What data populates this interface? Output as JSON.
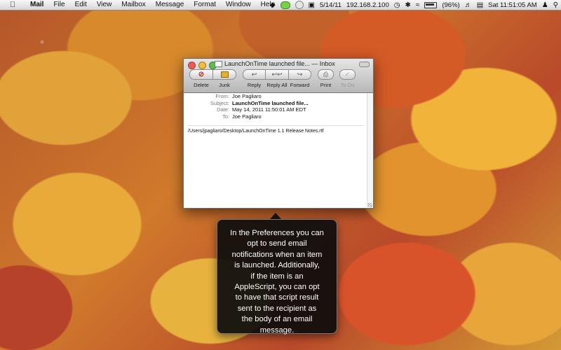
{
  "menubar": {
    "apple_icon": "apple-icon",
    "items": [
      "Mail",
      "File",
      "Edit",
      "View",
      "Mailbox",
      "Message",
      "Format",
      "Window",
      "Help"
    ],
    "date": "5/14/11",
    "ip": "192.168.2.100",
    "battery": "(96%)",
    "clock": "Sat 11:51:05 AM"
  },
  "window": {
    "title": "LaunchOnTime launched file... — Inbox",
    "toolbar": {
      "delete": "Delete",
      "junk": "Junk",
      "reply": "Reply",
      "reply_all": "Reply All",
      "forward": "Forward",
      "print": "Print",
      "todo": "To Do"
    },
    "headers": {
      "from_label": "From:",
      "from": "Joe Pagliaro",
      "subject_label": "Subject:",
      "subject": "LaunchOnTime launched file...",
      "date_label": "Date:",
      "date": "May 14, 2011 11:50:01 AM EDT",
      "to_label": "To:",
      "to": "Joe Pagliaro"
    },
    "body": "/Users/jpagliaro/Desktop/LaunchOnTime 1.1 Release Notes.rtf"
  },
  "tooltip": {
    "lines": [
      "In the Preferences you can",
      "opt to send email",
      "notifications when an item",
      "is launched. Additionally,",
      "if the item is an",
      "AppleScript, you can opt",
      "to have that script result",
      "sent to the recipient as",
      "the body of an email",
      "message."
    ]
  }
}
